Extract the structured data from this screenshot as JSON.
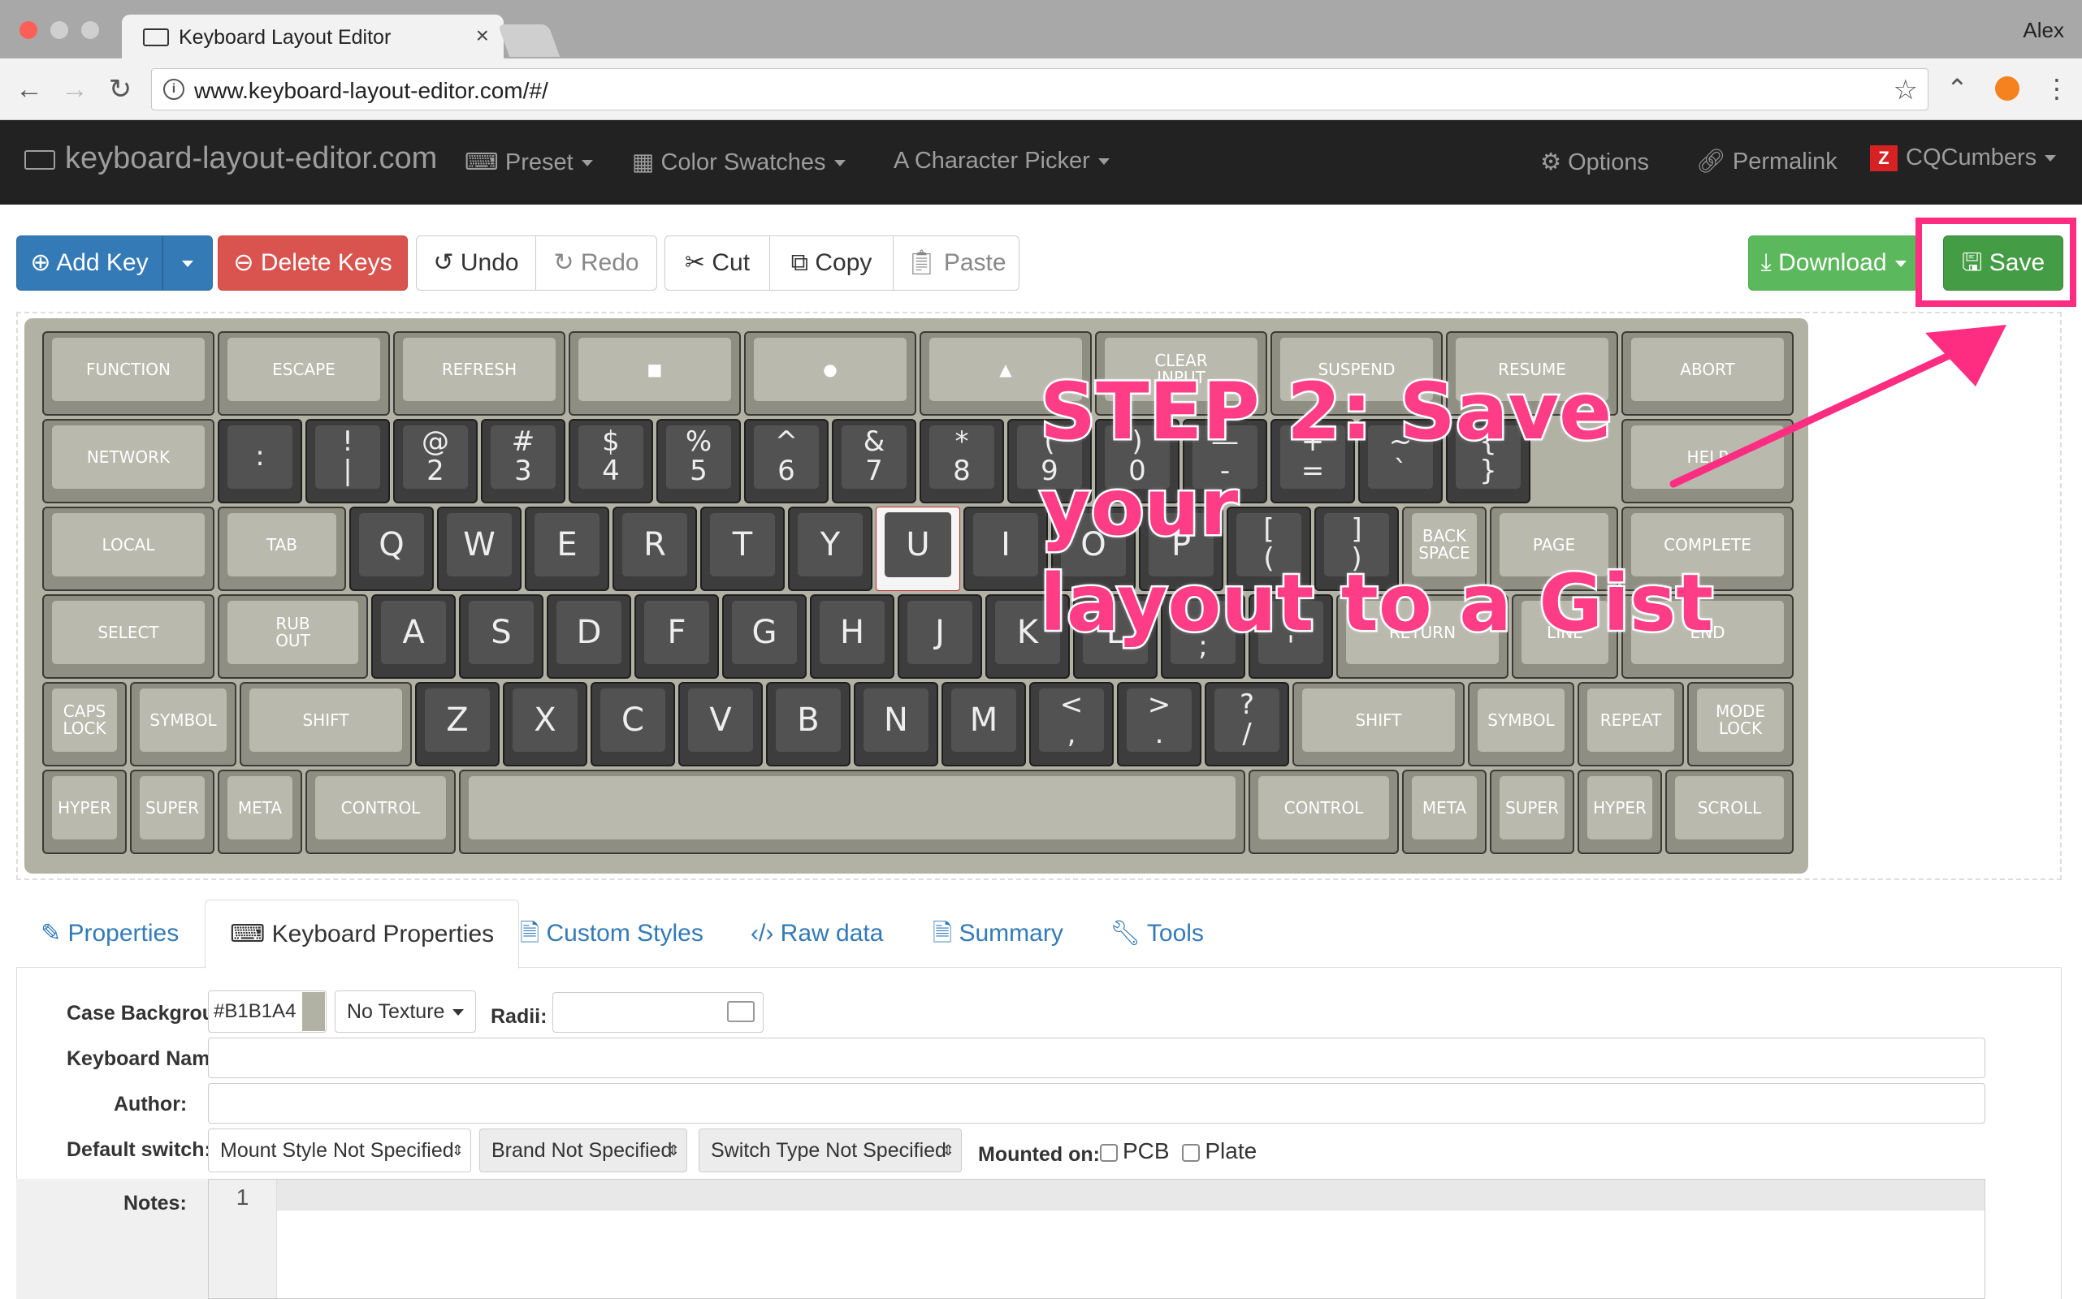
{
  "browser": {
    "tab_title": "Keyboard Layout Editor",
    "tab_close": "×",
    "profile": "Alex",
    "url": "www.keyboard-layout-editor.com/#/"
  },
  "colors": {
    "case": "#B1B1A4",
    "callout": "#ff3d86",
    "save_button": "#449d44",
    "download_button": "#5cb85c",
    "add_key_button": "#337ab7",
    "delete_button": "#d9534f"
  },
  "navbar": {
    "brand": "keyboard-layout-editor.com",
    "preset": "Preset",
    "color_swatches": "Color Swatches",
    "character_picker": "Character Picker",
    "options": "Options",
    "permalink": "Permalink",
    "user": "CQCumbers"
  },
  "toolbar": {
    "add_key": "Add Key",
    "delete_keys": "Delete Keys",
    "undo": "Undo",
    "redo": "Redo",
    "cut": "Cut",
    "copy": "Copy",
    "paste": "Paste",
    "download": "Download",
    "save": "Save"
  },
  "callout": {
    "line1": "STEP 2: Save your",
    "line2": "layout to a Gist"
  },
  "keyboard_rows": [
    [
      "FUNCTION",
      "ESCAPE",
      "REFRESH",
      "■",
      "●",
      "▲",
      "CLEAR INPUT",
      "SUSPEND",
      "RESUME",
      "ABORT"
    ],
    [
      "NETWORK",
      ":",
      "! |",
      "@ 2",
      "# 3",
      "$ 4",
      "% 5",
      "^ 6",
      "& 7",
      "* 8",
      "( 9",
      ") 0",
      "— -",
      "+ =",
      "~ `",
      "{ }",
      "HELP"
    ],
    [
      "LOCAL",
      "TAB",
      "Q",
      "W",
      "E",
      "R",
      "T",
      "Y",
      "U",
      "I",
      "O",
      "P",
      "[ (",
      "] )",
      "BACK SPACE",
      "PAGE",
      "COMPLETE"
    ],
    [
      "SELECT",
      "RUB OUT",
      "A",
      "S",
      "D",
      "F",
      "G",
      "H",
      "J",
      "K",
      "L",
      ": ;",
      "\" '",
      "RETURN",
      "LINE",
      "END"
    ],
    [
      "CAPS LOCK",
      "SYMBOL",
      "SHIFT",
      "Z",
      "X",
      "C",
      "V",
      "B",
      "N",
      "M",
      "< ,",
      "> .",
      "? /",
      "SHIFT",
      "SYMBOL",
      "REPEAT",
      "MODE LOCK"
    ],
    [
      "HYPER",
      "SUPER",
      "META",
      "CONTROL",
      "",
      "CONTROL",
      "META",
      "SUPER",
      "HYPER",
      "SCROLL"
    ]
  ],
  "selected_key": "U",
  "tabs": {
    "properties": "Properties",
    "keyboard_properties": "Keyboard Properties",
    "custom_styles": "Custom Styles",
    "raw_data": "Raw data",
    "summary": "Summary",
    "tools": "Tools"
  },
  "form": {
    "case_background_label": "Case Backgrou",
    "case_background_value": "#B1B1A4",
    "texture": "No Texture",
    "radii_label": "Radii:",
    "radii_value": "",
    "keyboard_name_label": "Keyboard Name",
    "keyboard_name_value": "",
    "author_label": "Author:",
    "author_value": "",
    "default_switch_label": "Default switch:",
    "mount_style": "Mount Style Not Specified",
    "brand": "Brand Not Specified",
    "switch_type": "Switch Type Not Specified",
    "mounted_on_label": "Mounted on:",
    "pcb": "PCB",
    "plate": "Plate",
    "notes_label": "Notes:",
    "notes_line": "1"
  }
}
